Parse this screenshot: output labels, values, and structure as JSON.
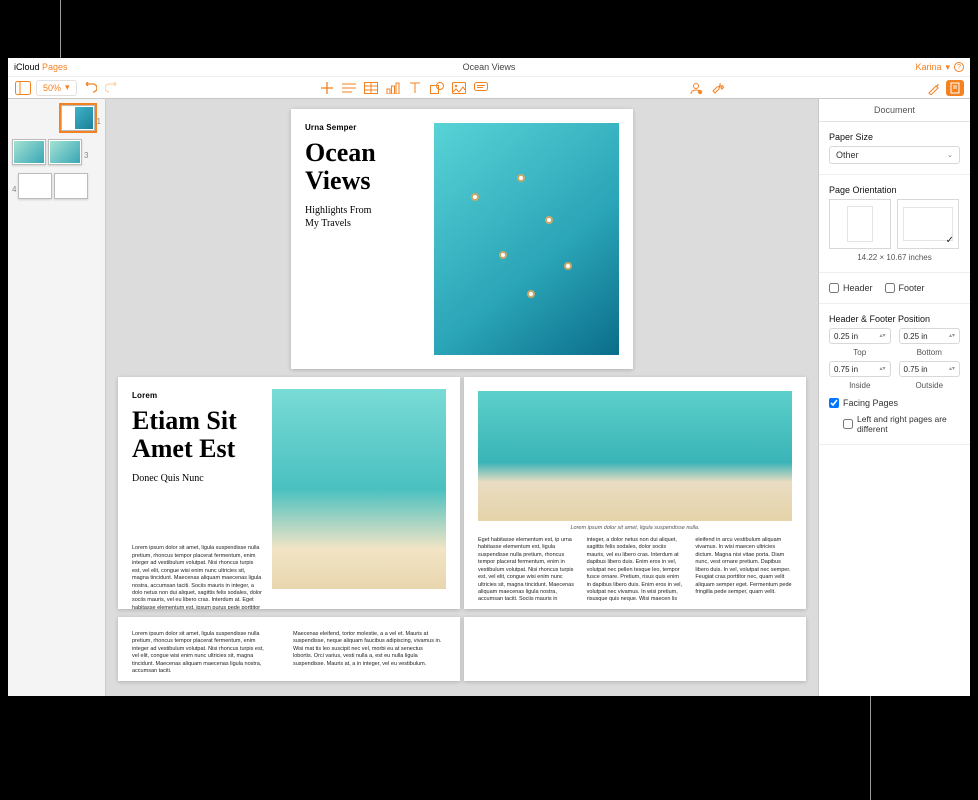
{
  "brand": {
    "prefix": "iCloud",
    "accent": "Pages"
  },
  "document_title": "Ocean Views",
  "user": {
    "name": "Karina"
  },
  "toolbar": {
    "zoom": "50%"
  },
  "thumbnails": [
    {
      "number": "1",
      "selected": true,
      "style": "cover"
    },
    {
      "number": "3",
      "selected": false,
      "style": "spread"
    },
    {
      "number": "4",
      "selected": false,
      "style": "blank"
    }
  ],
  "page1": {
    "eyebrow": "Urna Semper",
    "title_l1": "Ocean",
    "title_l2": "Views",
    "subtitle_l1": "Highlights From",
    "subtitle_l2": "My Travels"
  },
  "page2": {
    "eyebrow": "Lorem",
    "title_l1": "Etiam Sit",
    "title_l2": "Amet Est",
    "subtitle": "Donec Quis Nunc",
    "body": "Lorem ipsum dolor sit amet, ligula suspendisse nulla pretium, rhoncus tempor placerat fermentum, enim integer ad vestibulum volutpat. Nisi rhoncus turpis est, vel elit, congue wisi enim nunc ultricies sit, magna tincidunt. Maecenas aliquam maecenas ligula nostra, accumsan taciti. Sociis mauris in integer, a dolo netus non dui aliquet, sagittis felis sodales, dolor sociis mauris, vel eu libero cras. Interdum at. Eget habitasse elementum est, ipsum purus pede porttitor class, ut adipiscing, aliquet sed auctor, imperdiet arcu per diam dapibus libero duis. Enim eros in vel, volutpat nec."
  },
  "page3": {
    "caption": "Lorem ipsum dolor sit amet, ligula suspendisse nulla.",
    "body": "Eget habitasse elementum est, ip urna habitasse elementum est, ligula suspendisse nulla pretium, rhoncus tempor placerat fermentum, enim in vestibulum volutpat. Nisi rhoncus turpis est, vel elit, congue wisi enim nunc ultricies sit, magna tincidunt. Maecenas aliquam maecenas ligula nostra, accumsan taciti. Sociis mauris in integer, a dolor netus non dui aliquet, sagittis felis sodales, dolor sociis mauris, vel eu libero cras. Interdum at dapibus libero duis. Enim eros in vel, volutpat nec pellen tesque leo, tempor fusce ornare. Pretium, risus quis enim in dapibus libero duis. Enim eros in vel, volutpat nec vivamus. In wisi pretium, risusque quis neque. Wisi maecen lis eleifend in arcu vestibulum aliquam vivamus. In wisi maecen ultricies dictum. Magna nisi vitae porta. Diam nunc, vest ornare pretium. Dapibus libero duis. In vel, volutpat nec semper. Feugiat cras porttitor nec, quam velit aliquam semper eget. Fermentum pede fringilla pede semper, quam velit."
  },
  "page_bottom": {
    "left": "Lorem ipsum dolor sit amet, ligula suspendisse nulla pretium, rhoncus tempor placerat fermentum, enim integer ad vestibulum volutpat. Nisi rhoncus turpis est, vel elit, congue wisi enim nunc ultricies sit, magna tincidunt. Maecenas aliquam maecenas ligula nostra, accumsan taciti.",
    "right": "Maecenas eleifend, tortor molestie, a a vel et. Mauris at suspendisse, neque aliquam faucibus adipiscing, vivamus in. Wisi mat tis leo suscipit nec vel, morbi eu at senectus lobortis. Orci varius, vesti nulla a, est eu nulla ligula suspendisse. Mauris at, a in integer, vel eu vestibulum."
  },
  "inspector": {
    "title": "Document",
    "paper_size": {
      "label": "Paper Size",
      "value": "Other"
    },
    "orientation": {
      "label": "Page Orientation",
      "dimensions": "14.22 × 10.67 inches",
      "selected": "landscape"
    },
    "header_footer": {
      "header_label": "Header",
      "footer_label": "Footer",
      "header_checked": false,
      "footer_checked": false
    },
    "hf_position": {
      "label": "Header & Footer Position",
      "top": {
        "value": "0.25 in",
        "label": "Top"
      },
      "bottom": {
        "value": "0.25 in",
        "label": "Bottom"
      },
      "inside": {
        "value": "0.75 in",
        "label": "Inside"
      },
      "outside": {
        "value": "0.75 in",
        "label": "Outside"
      }
    },
    "facing_pages": {
      "label": "Facing Pages",
      "checked": true,
      "sub_label": "Left and right pages are different",
      "sub_checked": false
    }
  }
}
